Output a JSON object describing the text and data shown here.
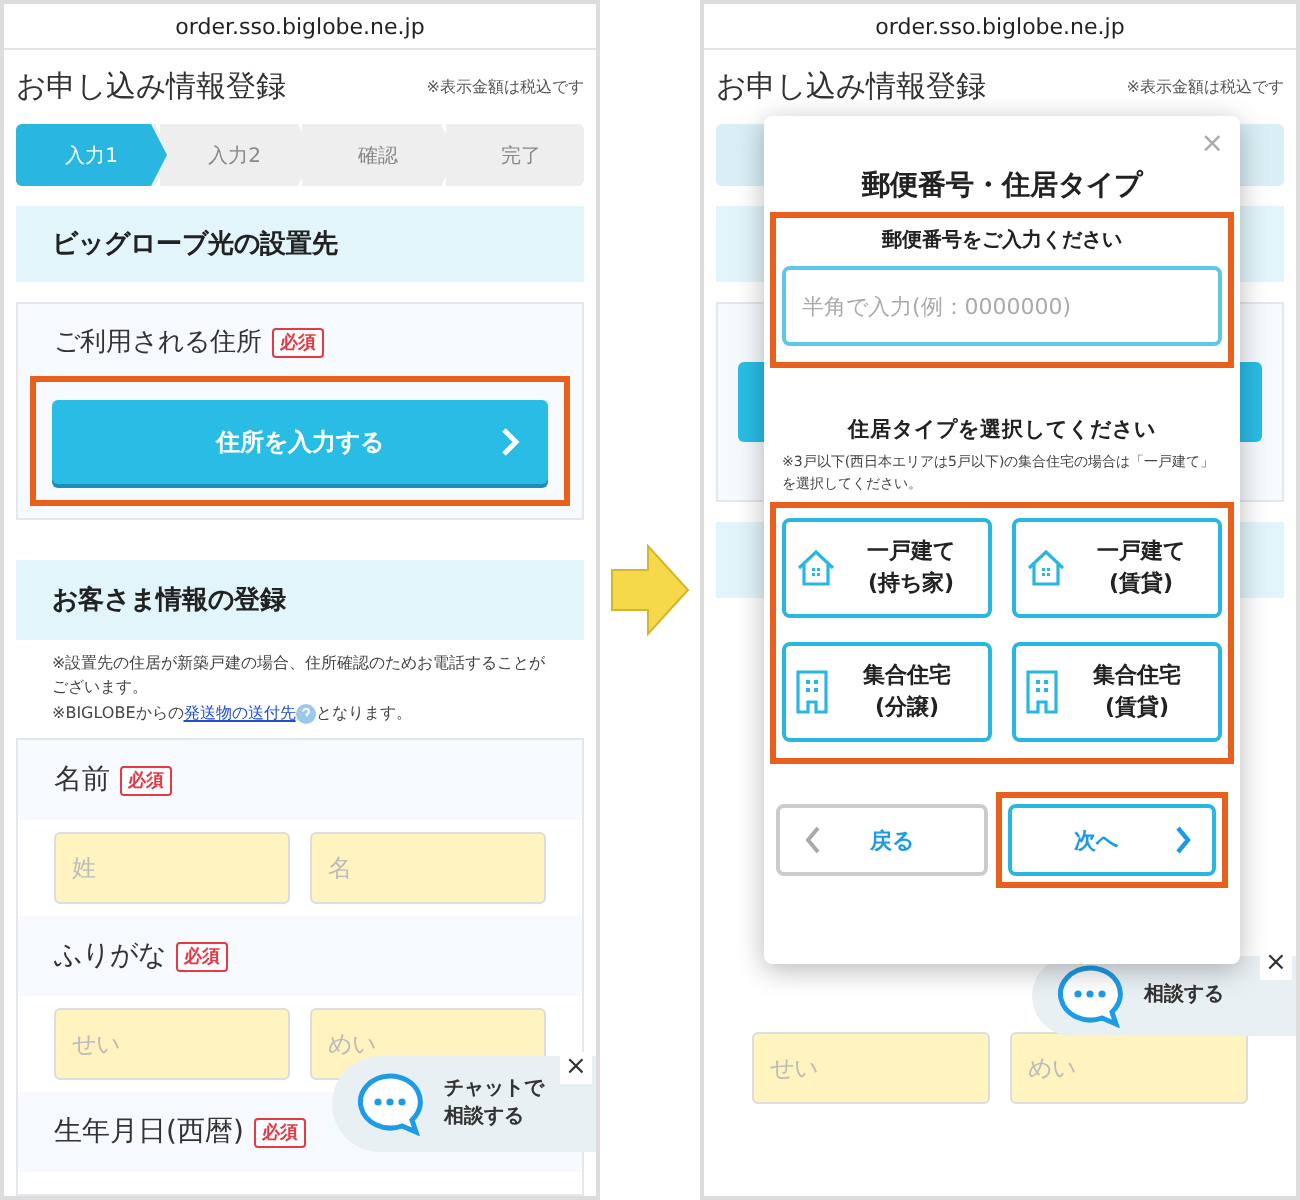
{
  "left": {
    "url": "order.sso.biglobe.ne.jp",
    "page_title": "お申し込み情報登録",
    "tax_note": "※表示金額は税込です",
    "steps": [
      {
        "label": "入力1",
        "selected": true
      },
      {
        "label": "入力2",
        "selected": false
      },
      {
        "label": "確認",
        "selected": false
      },
      {
        "label": "完了",
        "selected": false
      }
    ],
    "install_section": {
      "heading": "ビッグローブ光の設置先",
      "field_label": "ご利用される住所",
      "required": "必須",
      "address_button": "住所を入力する",
      "highlighted": true
    },
    "customer_section": {
      "heading": "お客さま情報の登録",
      "note": "※設置先の住居が新築戸建の場合、住所確認のためお電話することがございます。",
      "note2_prefix": "※BIGLOBEからの",
      "note2_link": "発送物の送付先",
      "note2_suffix": "となります。"
    },
    "form_rows": [
      {
        "label": "名前",
        "required": "必須",
        "placeholders": [
          "姓",
          "名"
        ]
      },
      {
        "label": "ふりがな",
        "required": "必須",
        "placeholders": [
          "せい",
          "めい"
        ]
      },
      {
        "label": "生年月日(西暦)",
        "required": "必須",
        "placeholders": []
      }
    ],
    "chat": {
      "line1": "チャットで",
      "line2": "相談する",
      "close": "×"
    }
  },
  "right": {
    "url": "order.sso.biglobe.ne.jp",
    "page_title": "お申し込み情報登録",
    "tax_note": "※表示金額は税込です",
    "chat_text": "相談する",
    "chat_close": "×",
    "placeholders": [
      "せい",
      "めい"
    ],
    "modal": {
      "close": "×",
      "title": "郵便番号・住居タイプ",
      "postal": {
        "label": "郵便番号をご入力ください",
        "placeholder": "半角で入力(例：0000000)",
        "highlighted": true
      },
      "housing": {
        "label": "住居タイプを選択してください",
        "note": "※3戸以下(西日本エリアは5戸以下)の集合住宅の場合は「一戸建て」を選択してください。",
        "highlighted": true,
        "options": [
          {
            "kind": "house",
            "line1": "一戸建て",
            "line2": "(持ち家)",
            "selected": false
          },
          {
            "kind": "house",
            "line1": "一戸建て",
            "line2": "(賃貸)",
            "selected": false
          },
          {
            "kind": "building",
            "line1": "集合住宅",
            "line2": "(分譲)",
            "selected": false
          },
          {
            "kind": "building",
            "line1": "集合住宅",
            "line2": "(賃貸)",
            "selected": false
          }
        ]
      },
      "back": "戻る",
      "next": "次へ",
      "next_highlighted": true
    }
  }
}
